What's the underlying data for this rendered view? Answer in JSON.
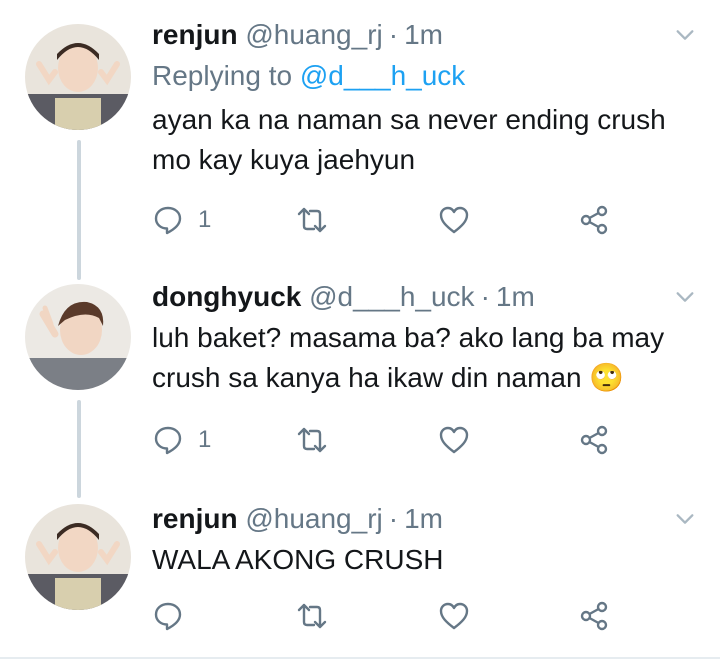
{
  "tweets": [
    {
      "name": "renjun",
      "handle": "@huang_rj",
      "separator": "·",
      "time": "1m",
      "replying_prefix": "Replying to ",
      "replying_to": "@d___h_uck",
      "text_line1": "ayan ka na naman sa never ending crush",
      "text_line2": "mo kay kuya jaehyun",
      "reply_count": "1",
      "avatar": "avatar-renjun"
    },
    {
      "name": "donghyuck",
      "handle": "@d___h_uck",
      "separator": "·",
      "time": "1m",
      "text_line1": "luh baket? masama ba? ako lang ba may",
      "text_line2": "crush sa kanya ha ikaw din naman",
      "emoji": "🙄",
      "reply_count": "1",
      "avatar": "avatar-donghyuck"
    },
    {
      "name": "renjun",
      "handle": "@huang_rj",
      "separator": "·",
      "time": "1m",
      "text_line1": "WALA AKONG CRUSH",
      "reply_count": "",
      "avatar": "avatar-renjun"
    }
  ],
  "icons": {
    "reply": "reply-icon",
    "retweet": "retweet-icon",
    "like": "heart-icon",
    "share": "share-icon",
    "caret": "chevron-down-icon"
  },
  "colors": {
    "link": "#1da1f2",
    "secondary": "#657786",
    "thread_line": "#ccd6dd"
  }
}
